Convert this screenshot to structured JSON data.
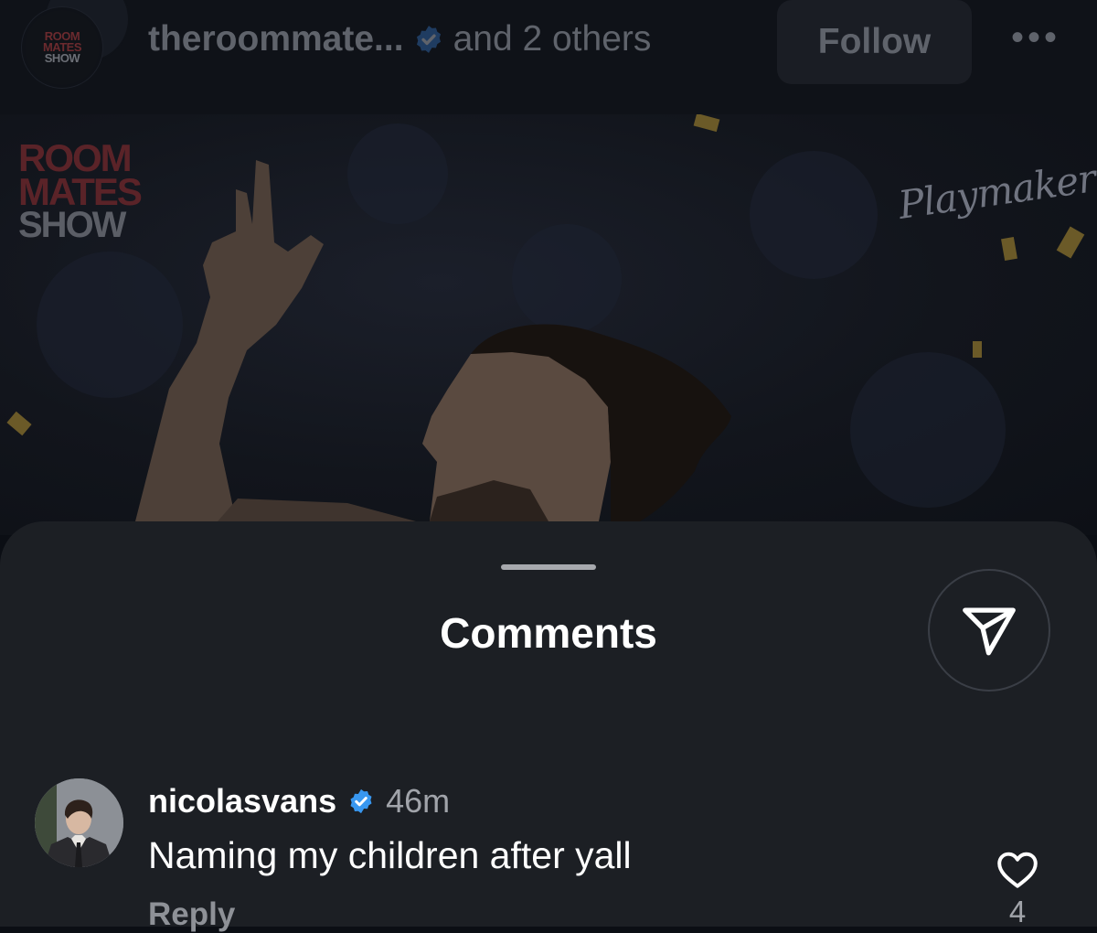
{
  "header": {
    "username": "theroommate...",
    "others_text": "and 2 others",
    "follow_label": "Follow",
    "more_label": "•••",
    "avatar_text": [
      "ROOM",
      "MATES",
      "SHOW"
    ]
  },
  "media": {
    "logo_lines": [
      "ROOM",
      "MATES",
      "SHOW"
    ],
    "watermark": "Playmaker"
  },
  "comments_sheet": {
    "title": "Comments",
    "comments": [
      {
        "username": "nicolasvans",
        "time": "46m",
        "text": "Naming my children after yall",
        "reply_label": "Reply",
        "like_count": "4"
      }
    ]
  },
  "colors": {
    "sheet_background": "#1c1f24",
    "verified_blue": "#3897f0",
    "text_primary": "#ffffff",
    "text_secondary": "#a1a4aa"
  }
}
